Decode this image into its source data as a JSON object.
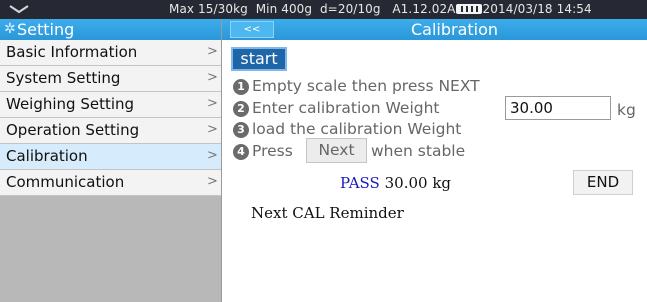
{
  "status_bar": {
    "info": "Max 15/30kg  Min 400g  d=20/10g   A1.12.02A",
    "date": "2014/03/18",
    "time": "14:54",
    "icons": [
      "logo-icon",
      "battery-icon"
    ]
  },
  "sidebar": {
    "title": "Setting",
    "items": [
      {
        "label": "Basic Information",
        "icon": "chevron-right-icon"
      },
      {
        "label": "System Setting",
        "icon": "chevron-right-icon"
      },
      {
        "label": "Weighing Setting",
        "icon": "chevron-right-icon"
      },
      {
        "label": "Operation Setting",
        "icon": "chevron-right-icon"
      },
      {
        "label": "Calibration",
        "icon": "chevron-right-icon",
        "active": true
      },
      {
        "label": "Communication",
        "icon": "chevron-right-icon"
      }
    ],
    "chevron": ">"
  },
  "header": {
    "back_label": "<<",
    "title": "Calibration"
  },
  "calibration": {
    "start_label": "start",
    "steps": [
      {
        "num": "1",
        "text": "Empty scale then press NEXT"
      },
      {
        "num": "2",
        "text": "Enter  calibration Weight"
      },
      {
        "num": "3",
        "text": "load the calibration Weight"
      },
      {
        "num": "4",
        "text_before": "Press",
        "text_after": "when stable"
      }
    ],
    "weight_value": "30.00",
    "unit": "kg",
    "next_label": "Next",
    "result_status": "PASS",
    "result_value": "30.00 kg",
    "end_label": "END",
    "reminder": "Next CAL Reminder"
  },
  "colors": {
    "header": "#2a97d8",
    "status_bar": "#262833",
    "sidebar_bg": "#b8b8b8",
    "active_item": "#d6ebfb",
    "start_button": "#1f66a8",
    "pass_text": "#1a1ab8"
  }
}
